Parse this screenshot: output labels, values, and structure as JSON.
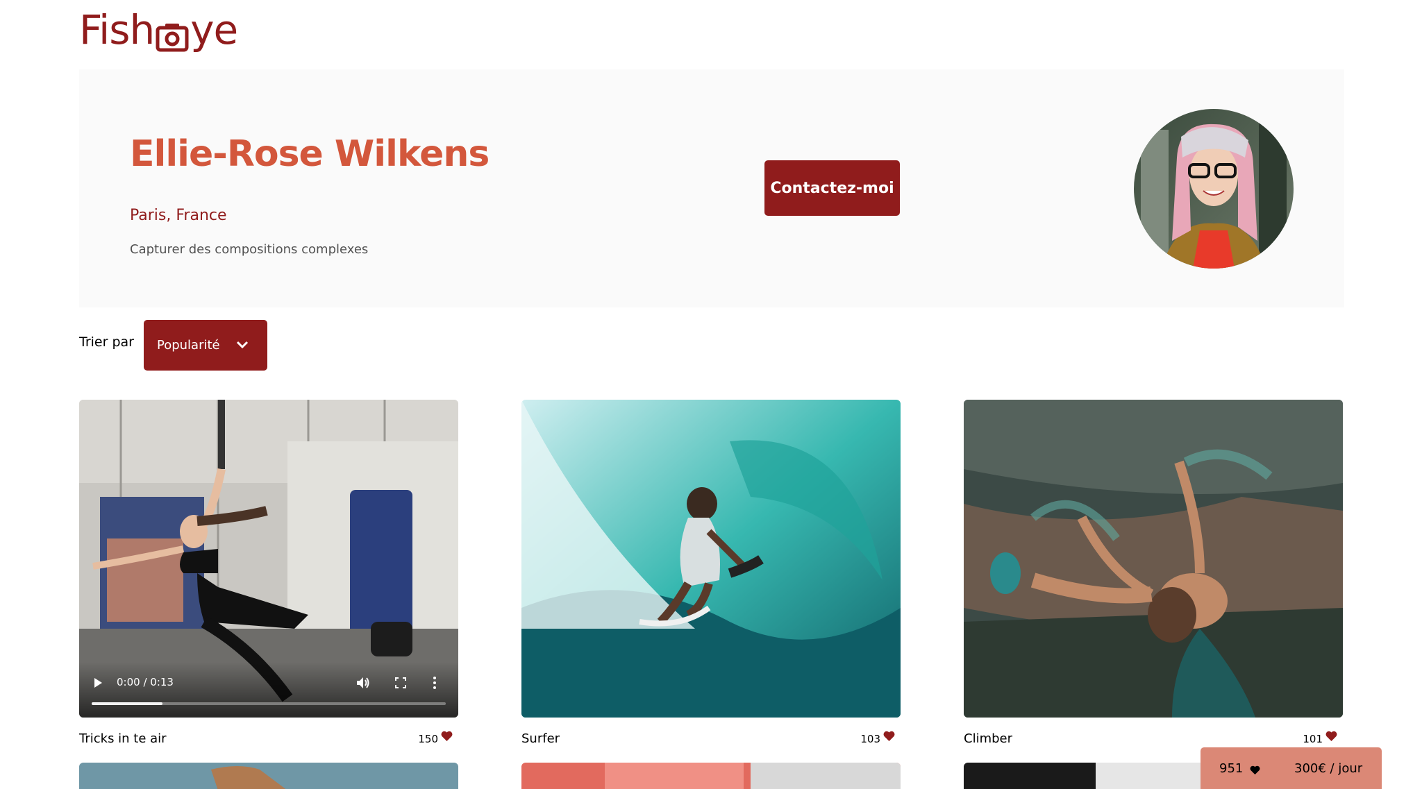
{
  "brand": {
    "logo_left": "Fish",
    "logo_right": "ye",
    "logo_color": "#901C1C"
  },
  "photographer": {
    "name": "Ellie-Rose Wilkens",
    "location": "Paris, France",
    "tagline": "Capturer des compositions complexes",
    "contact_label": "Contactez-moi",
    "avatar_icon": "avatar"
  },
  "sort": {
    "label": "Trier par",
    "selected": "Popularité"
  },
  "gallery": [
    {
      "title": "Tricks in te air",
      "likes": "150",
      "type": "video",
      "video": {
        "time": "0:00 / 0:13",
        "progress": 0.2
      }
    },
    {
      "title": "Surfer",
      "likes": "103",
      "type": "image"
    },
    {
      "title": "Climber",
      "likes": "101",
      "type": "image"
    }
  ],
  "stats": {
    "total_likes": "951",
    "price": "300€ / jour"
  },
  "colors": {
    "primary": "#901C1C",
    "secondary": "#D3573C",
    "stats_bg": "#DB8876",
    "header_bg": "#FAFAFA"
  }
}
